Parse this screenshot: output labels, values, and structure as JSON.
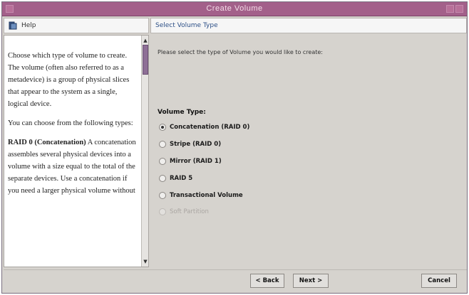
{
  "window": {
    "title": "Create Volume"
  },
  "help": {
    "header_label": "Help",
    "paragraphs": [
      "Choose which type of volume to create. The volume (often also referred to as a metadevice) is a group of physical slices that appear to the system as a single, logical device.",
      "You can choose from the following types:"
    ],
    "raid0_heading": "RAID 0 (Concatenation)",
    "raid0_text": "A concatenation assembles several physical devices into a volume with a size equal to the total of the separate devices. Use a concatenation if you need a larger physical volume without"
  },
  "section": {
    "header_label": "Select Volume Type"
  },
  "main": {
    "instruction": "Please select the type of Volume you would like to create:",
    "volume_type_label": "Volume Type:",
    "options": [
      {
        "label": "Concatenation (RAID 0)",
        "selected": true,
        "enabled": true
      },
      {
        "label": "Stripe (RAID 0)",
        "selected": false,
        "enabled": true
      },
      {
        "label": "Mirror (RAID 1)",
        "selected": false,
        "enabled": true
      },
      {
        "label": "RAID 5",
        "selected": false,
        "enabled": true
      },
      {
        "label": "Transactional Volume",
        "selected": false,
        "enabled": true
      },
      {
        "label": "Soft Partition",
        "selected": false,
        "enabled": false
      }
    ]
  },
  "buttons": {
    "back": "< Back",
    "next": "Next >",
    "cancel": "Cancel"
  },
  "colors": {
    "titlebar": "#a3608a",
    "window_bg": "#d6d3ce",
    "scroll_thumb": "#8e6f96"
  }
}
